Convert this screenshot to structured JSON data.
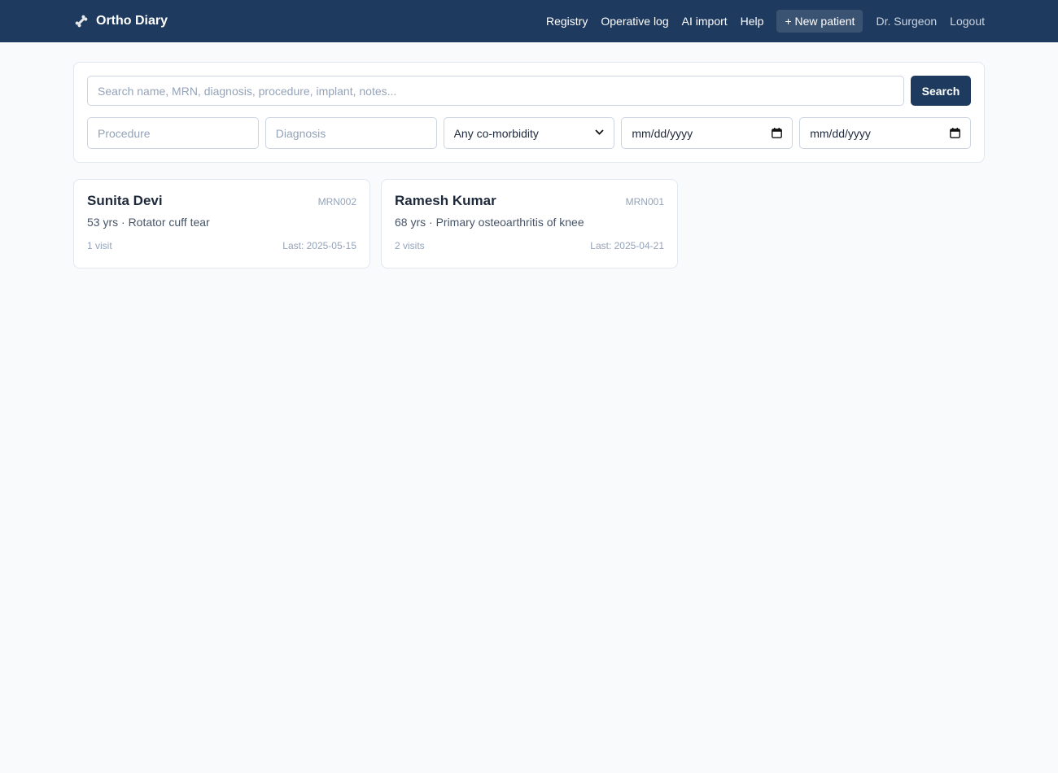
{
  "header": {
    "brand": "Ortho Diary",
    "nav": {
      "registry": "Registry",
      "operative_log": "Operative log",
      "ai_import": "AI import",
      "help": "Help",
      "new_patient": "+ New patient",
      "user": "Dr. Surgeon",
      "logout": "Logout"
    }
  },
  "search": {
    "placeholder": "Search name, MRN, diagnosis, procedure, implant, notes...",
    "button": "Search",
    "procedure_placeholder": "Procedure",
    "diagnosis_placeholder": "Diagnosis",
    "comorbidity_selected": "Any co-morbidity",
    "date_from": "mm/dd/yyyy",
    "date_to": "mm/dd/yyyy"
  },
  "patients": [
    {
      "name": "Sunita Devi",
      "mrn": "MRN002",
      "summary": "53 yrs · Rotator cuff tear",
      "visits": "1 visit",
      "last": "Last: 2025-05-15"
    },
    {
      "name": "Ramesh Kumar",
      "mrn": "MRN001",
      "summary": "68 yrs · Primary osteoarthritis of knee",
      "visits": "2 visits",
      "last": "Last: 2025-04-21"
    }
  ],
  "colors": {
    "header_bg": "#1e3a5f",
    "page_bg": "#f8fafc"
  },
  "icons": {
    "brand": "bone-icon",
    "date": "calendar-icon",
    "select": "chevron-down-icon"
  }
}
